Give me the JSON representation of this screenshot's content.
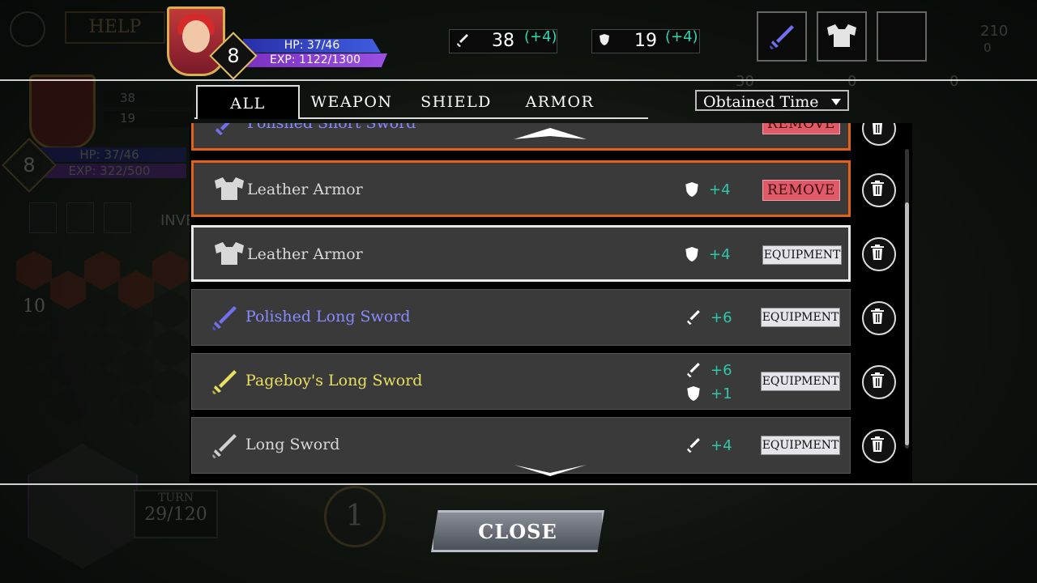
{
  "background": {
    "help_label": "HELP",
    "side_attack": "38",
    "side_defense": "19",
    "side_hp": "HP: 37/46",
    "side_exp": "EXP: 322/500",
    "side_level": "8",
    "side_inventory": "INVE",
    "hex_count": "10",
    "turn_label": "TURN",
    "turn_value": "29/120",
    "action_value": "1",
    "resources": [
      "210",
      "0",
      "30",
      "0",
      "0"
    ]
  },
  "hud": {
    "level": "8",
    "hp": "HP: 37/46",
    "exp": "EXP: 1122/1300",
    "attack": "38",
    "attack_bonus": "(+4)",
    "defense": "19",
    "defense_bonus": "(+4)"
  },
  "tabs": [
    "ALL",
    "WEAPON",
    "SHIELD",
    "ARMOR"
  ],
  "active_tab": "ALL",
  "sort": {
    "selected": "Obtained Time"
  },
  "items": [
    {
      "name": "Polished Short Sword",
      "color": "#8a8aff",
      "stats": [],
      "action": "REMOVE",
      "state": "equipped-partial"
    },
    {
      "name": "Leather Armor",
      "color": "#d8d8d8",
      "icon": "armor-icon",
      "stats": [
        {
          "icon": "shield-icon",
          "value": "+4"
        }
      ],
      "action": "REMOVE",
      "state": "equipped"
    },
    {
      "name": "Leather Armor",
      "color": "#d8d8d8",
      "icon": "armor-icon",
      "stats": [
        {
          "icon": "shield-icon",
          "value": "+4"
        }
      ],
      "action": "EQUIPMENT",
      "state": "selected"
    },
    {
      "name": "Polished Long Sword",
      "color": "#8a8aff",
      "icon": "sword-icon",
      "stats": [
        {
          "icon": "sword-icon",
          "value": "+6"
        }
      ],
      "action": "EQUIPMENT"
    },
    {
      "name": "Pageboy's Long Sword",
      "color": "#e8e060",
      "icon": "sword-icon",
      "stats": [
        {
          "icon": "sword-icon",
          "value": "+6"
        },
        {
          "icon": "shield-icon",
          "value": "+1"
        }
      ],
      "action": "EQUIPMENT"
    },
    {
      "name": "Long Sword",
      "color": "#d8d8d8",
      "icon": "sword-icon",
      "stats": [
        {
          "icon": "sword-icon",
          "value": "+4"
        }
      ],
      "action": "EQUIPMENT"
    }
  ],
  "close_label": "CLOSE"
}
